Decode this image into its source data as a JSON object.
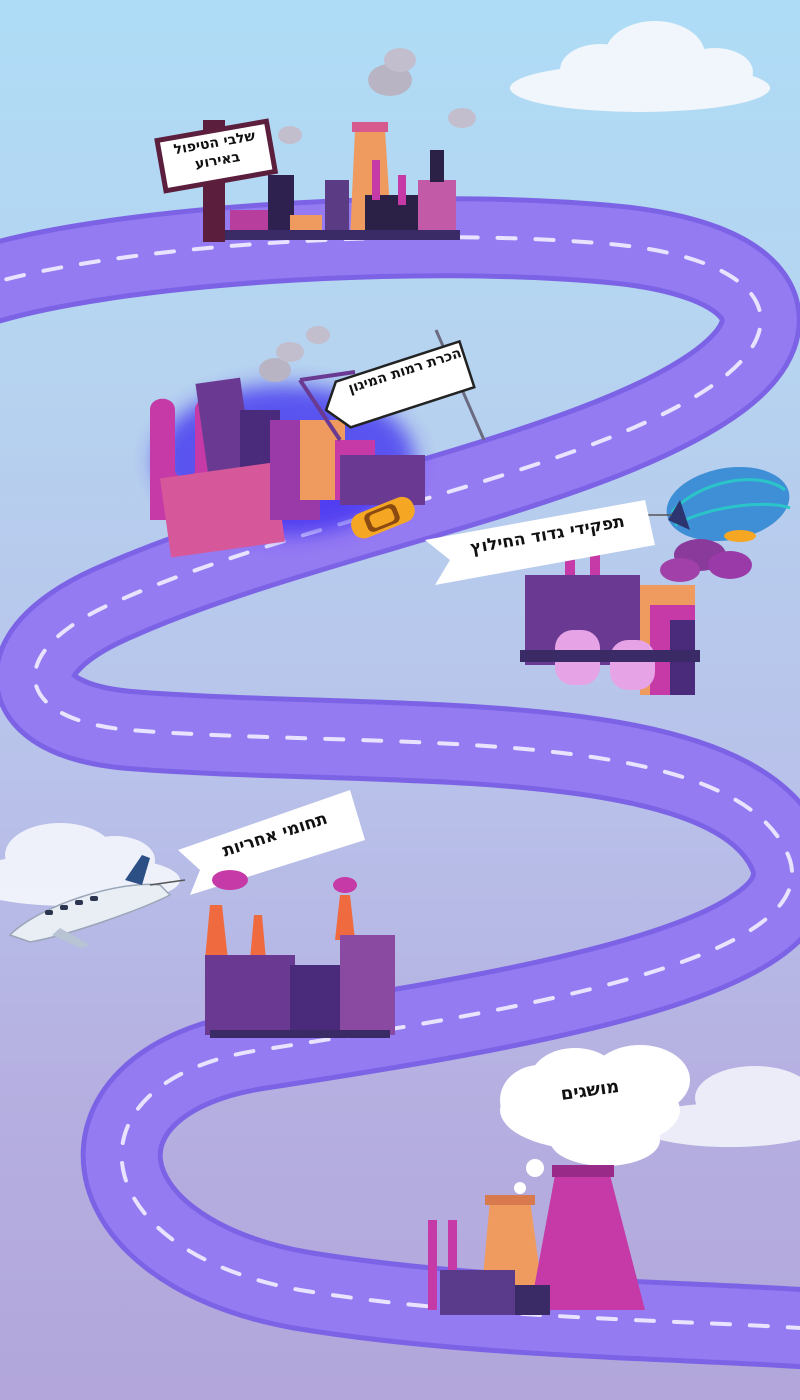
{
  "signs": {
    "stages": "שלבי הטיפול באירוע",
    "protection_levels": "הכרת רמות המיגון",
    "rescue_roles": "תפקידי גדוד החילוץ",
    "responsibilities": "תחומי אחריות",
    "concepts": "מושגים"
  },
  "colors": {
    "road": "#957bf2",
    "road_edge": "#7c63e6",
    "dash": "#e8e4ff",
    "factory_purple": "#6a3a92",
    "factory_pink": "#c53aa6",
    "factory_orange": "#ef9a5e",
    "taxi": "#f5a623",
    "blimp": "#3f8fd6"
  }
}
